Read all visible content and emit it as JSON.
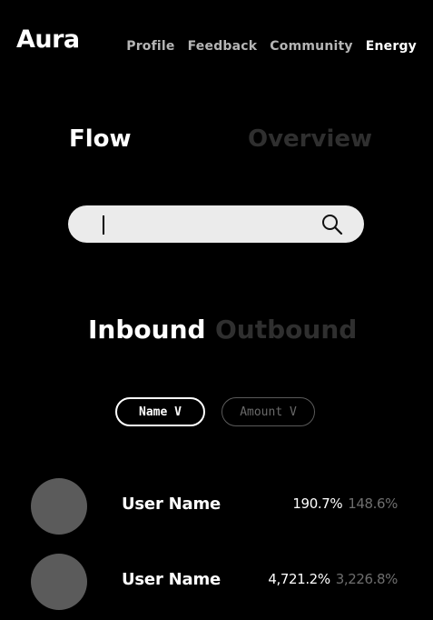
{
  "header": {
    "logo": "Aura",
    "nav": [
      {
        "label": "Profile",
        "active": false
      },
      {
        "label": "Feedback",
        "active": false
      },
      {
        "label": "Community",
        "active": false
      },
      {
        "label": "Energy",
        "active": true
      }
    ]
  },
  "view_tabs": {
    "active": "Flow",
    "items": [
      "Flow",
      "Overview"
    ]
  },
  "search": {
    "value": "",
    "icon": "search-icon"
  },
  "direction_tabs": {
    "active": "Inbound",
    "items": [
      "Inbound",
      "Outbound"
    ]
  },
  "sort": {
    "active": "Name V",
    "buttons": [
      "Name V",
      "Amount V"
    ]
  },
  "users": [
    {
      "name": "User Name",
      "primary": "190.7%",
      "secondary": "148.6%"
    },
    {
      "name": "User Name",
      "primary": "4,721.2%",
      "secondary": "3,226.8%"
    }
  ],
  "colors": {
    "background": "#000000",
    "active_text": "#ffffff",
    "inactive_text": "#2f2f2f",
    "avatar": "#5b5b5b",
    "search_bg": "#ebebeb"
  }
}
